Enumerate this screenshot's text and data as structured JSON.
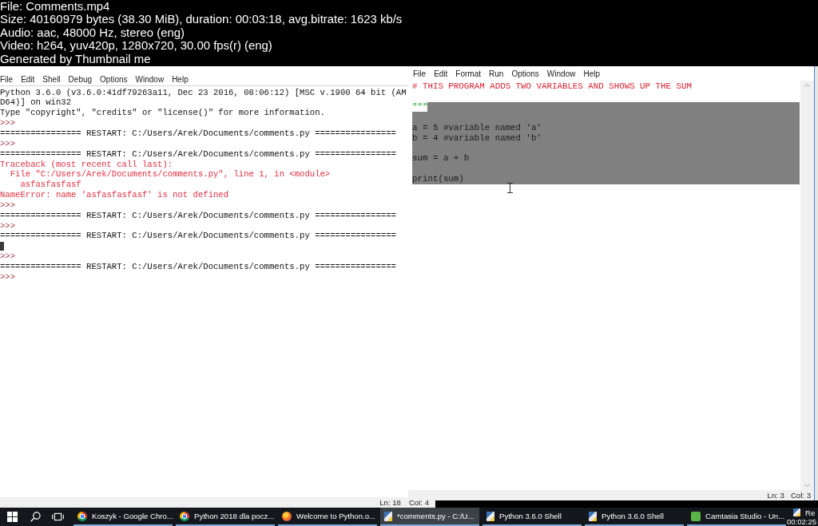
{
  "header": {
    "lines": [
      "File: Comments.mp4",
      "Size: 40160979 bytes (38.30 MiB), duration: 00:03:18, avg.bitrate: 1623 kb/s",
      "Audio: aac, 48000 Hz, stereo (eng)",
      "Video: h264, yuv420p, 1280x720, 30.00 fps(r) (eng)",
      "Generated by Thumbnail me"
    ]
  },
  "shell_window": {
    "menu": [
      "File",
      "Edit",
      "Shell",
      "Debug",
      "Options",
      "Window",
      "Help"
    ],
    "lines": [
      {
        "kind": "output",
        "text": "Python 3.6.0 (v3.6.0:41df79263a11, Dec 23 2016, 08:06:12) [MSC v.1900 64 bit (AM"
      },
      {
        "kind": "output",
        "text": "D64)] on win32"
      },
      {
        "kind": "output",
        "text": "Type \"copyright\", \"credits\" or \"license()\" for more information."
      },
      {
        "kind": "prompt",
        "text": ">>>"
      },
      {
        "kind": "output",
        "text": "================ RESTART: C:/Users/Arek/Documents/comments.py ================"
      },
      {
        "kind": "prompt",
        "text": ">>>"
      },
      {
        "kind": "output",
        "text": "================ RESTART: C:/Users/Arek/Documents/comments.py ================"
      },
      {
        "kind": "error",
        "text": "Traceback (most recent call last):"
      },
      {
        "kind": "error",
        "text": "  File \"C:/Users/Arek/Documents/comments.py\", line 1, in <module>"
      },
      {
        "kind": "error",
        "text": "    asfasfasfasf"
      },
      {
        "kind": "error",
        "text": "NameError: name 'asfasfasfasf' is not defined"
      },
      {
        "kind": "prompt",
        "text": ">>>"
      },
      {
        "kind": "output",
        "text": "================ RESTART: C:/Users/Arek/Documents/comments.py ================"
      },
      {
        "kind": "prompt",
        "text": ">>>"
      },
      {
        "kind": "output",
        "text": "================ RESTART: C:/Users/Arek/Documents/comments.py ================"
      },
      {
        "kind": "caret"
      },
      {
        "kind": "prompt",
        "text": ">>>"
      },
      {
        "kind": "output",
        "text": "================ RESTART: C:/Users/Arek/Documents/comments.py ================"
      },
      {
        "kind": "prompt",
        "text": ">>>"
      }
    ],
    "status": {
      "line": "Ln: 18",
      "column": "Col: 4"
    }
  },
  "editor_window": {
    "menu": [
      "File",
      "Edit",
      "Format",
      "Run",
      "Options",
      "Window",
      "Help"
    ],
    "lines": [
      {
        "kind": "comment",
        "text": "# THIS PROGRAM ADDS TWO VARIABLES AND SHOWS UP THE SUM",
        "selected": false,
        "text_selected": false
      },
      {
        "kind": "blank",
        "selected": false
      },
      {
        "kind": "string",
        "text": "\"\"\"",
        "selected": true,
        "text_selected": false
      },
      {
        "kind": "blank",
        "selected": true
      },
      {
        "kind": "code",
        "text": "a = 5 #variable named 'a'",
        "selected": true,
        "text_selected": true
      },
      {
        "kind": "code",
        "text": "b = 4 #variable named 'b'",
        "selected": true,
        "text_selected": true
      },
      {
        "kind": "blank",
        "selected": true
      },
      {
        "kind": "code",
        "text": "sum = a + b",
        "selected": true,
        "text_selected": true
      },
      {
        "kind": "blank",
        "selected": true
      },
      {
        "kind": "code",
        "text": "print(sum)",
        "selected": true,
        "text_selected": true
      }
    ],
    "status": {
      "line": "Ln: 3",
      "column": "Col: 3"
    }
  },
  "taskbar": {
    "apps": [
      {
        "label": "Koszyk - Google Chro...",
        "kind": "ring",
        "selected": false
      },
      {
        "label": "Python 2018 dla pocz...",
        "kind": "ring",
        "selected": false
      },
      {
        "label": "Welcome to Python.o...",
        "kind": "orb",
        "selected": false
      },
      {
        "label": "*comments.py - C:/U...",
        "kind": "page",
        "selected": true
      },
      {
        "label": "Python 3.6.0 Shell",
        "kind": "page",
        "selected": false
      },
      {
        "label": "Python 3.6.0 Shell",
        "kind": "page",
        "selected": false
      },
      {
        "label": "Camtasia Studio - Un...",
        "kind": "tile",
        "selected": false
      },
      {
        "label": "Re",
        "kind": "page",
        "selected": false
      }
    ]
  },
  "video_timestamp": "00:02:25"
}
